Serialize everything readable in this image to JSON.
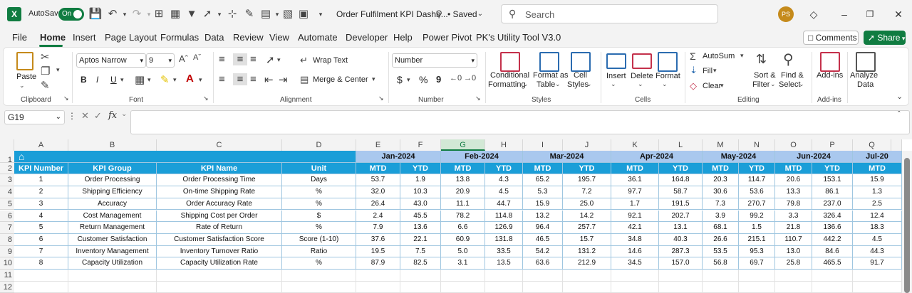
{
  "titlebar": {
    "app_logo": "X",
    "autosave_label": "AutoSave",
    "autosave_state": "On",
    "doc_title": "Order Fulfilment KPI Dashb...",
    "save_status": "• Saved",
    "search_placeholder": "Search",
    "avatar_initials": "PS"
  },
  "menu": {
    "items": [
      "File",
      "Home",
      "Insert",
      "Page Layout",
      "Formulas",
      "Data",
      "Review",
      "View",
      "Automate",
      "Developer",
      "Help",
      "Power Pivot",
      "PK's Utility Tool V3.0"
    ],
    "active": "Home",
    "comments_label": "Comments",
    "share_label": "Share"
  },
  "ribbon": {
    "clipboard": {
      "paste": "Paste",
      "label": "Clipboard"
    },
    "font": {
      "family": "Aptos Narrow",
      "size": "9",
      "bold": "B",
      "italic": "I",
      "underline": "U",
      "label": "Font"
    },
    "alignment": {
      "wrap_text": "Wrap Text",
      "merge_center": "Merge & Center",
      "label": "Alignment"
    },
    "number": {
      "format": "Number",
      "currency": "$",
      "percent": "%",
      "comma": "9",
      "label": "Number"
    },
    "styles": {
      "conditional": "Conditional",
      "formatting": "Formatting",
      "format_as": "Format as",
      "table": "Table",
      "cell": "Cell",
      "cell_styles": "Styles",
      "label": "Styles"
    },
    "cells": {
      "insert": "Insert",
      "delete": "Delete",
      "format": "Format",
      "label": "Cells"
    },
    "editing": {
      "autosum": "AutoSum",
      "fill": "Fill",
      "clear": "Clear",
      "sort": "Sort &",
      "filter": "Filter",
      "find": "Find &",
      "select": "Select",
      "label": "Editing"
    },
    "addins": {
      "addins": "Add-ins",
      "label": "Add-ins"
    },
    "analyze": {
      "line1": "Analyze",
      "line2": "Data"
    }
  },
  "formula_bar": {
    "name_box": "G19",
    "fx": "fx",
    "formula": ""
  },
  "grid": {
    "columns": [
      "A",
      "B",
      "C",
      "D",
      "E",
      "F",
      "G",
      "H",
      "I",
      "J",
      "K",
      "L",
      "M",
      "N",
      "O",
      "P",
      "Q"
    ],
    "selected_column": "G",
    "row_numbers": [
      "1",
      "2",
      "3",
      "4",
      "5",
      "6",
      "7",
      "8",
      "9",
      "10",
      "11",
      "12"
    ],
    "months": [
      "Jan-2024",
      "Feb-2024",
      "Mar-2024",
      "Apr-2024",
      "May-2024",
      "Jun-2024",
      "Jul-20"
    ],
    "headers": [
      "KPI Number",
      "KPI Group",
      "KPI Name",
      "Unit"
    ],
    "mtd": "MTD",
    "ytd": "YTD",
    "rows": [
      {
        "num": "1",
        "group": "Order Processing",
        "name": "Order Processing Time",
        "unit": "Days",
        "vals": [
          "53.7",
          "1.9",
          "13.8",
          "4.3",
          "65.2",
          "195.7",
          "36.1",
          "164.8",
          "20.3",
          "114.7",
          "20.6",
          "153.1",
          "15.9"
        ]
      },
      {
        "num": "2",
        "group": "Shipping Efficiency",
        "name": "On-time Shipping Rate",
        "unit": "%",
        "vals": [
          "32.0",
          "10.3",
          "20.9",
          "4.5",
          "5.3",
          "7.2",
          "97.7",
          "58.7",
          "30.6",
          "53.6",
          "13.3",
          "86.1",
          "1.3"
        ]
      },
      {
        "num": "3",
        "group": "Accuracy",
        "name": "Order Accuracy Rate",
        "unit": "%",
        "vals": [
          "26.4",
          "43.0",
          "11.1",
          "44.7",
          "15.9",
          "25.0",
          "1.7",
          "191.5",
          "7.3",
          "270.7",
          "79.8",
          "237.0",
          "2.5"
        ]
      },
      {
        "num": "4",
        "group": "Cost Management",
        "name": "Shipping Cost per Order",
        "unit": "$",
        "vals": [
          "2.4",
          "45.5",
          "78.2",
          "114.8",
          "13.2",
          "14.2",
          "92.1",
          "202.7",
          "3.9",
          "99.2",
          "3.3",
          "326.4",
          "12.4"
        ]
      },
      {
        "num": "5",
        "group": "Return Management",
        "name": "Rate of Return",
        "unit": "%",
        "vals": [
          "7.9",
          "13.6",
          "6.6",
          "126.9",
          "96.4",
          "257.7",
          "42.1",
          "13.1",
          "68.1",
          "1.5",
          "21.8",
          "136.6",
          "18.3"
        ]
      },
      {
        "num": "6",
        "group": "Customer Satisfaction",
        "name": "Customer Satisfaction Score",
        "unit": "Score (1-10)",
        "vals": [
          "37.6",
          "22.1",
          "60.9",
          "131.8",
          "46.5",
          "15.7",
          "34.8",
          "40.3",
          "26.6",
          "215.1",
          "110.7",
          "442.2",
          "4.5"
        ]
      },
      {
        "num": "7",
        "group": "Inventory Management",
        "name": "Inventory Turnover Ratio",
        "unit": "Ratio",
        "vals": [
          "19.5",
          "7.5",
          "5.0",
          "33.5",
          "54.2",
          "131.2",
          "14.6",
          "287.3",
          "53.5",
          "95.3",
          "13.0",
          "84.6",
          "44.3"
        ]
      },
      {
        "num": "8",
        "group": "Capacity Utilization",
        "name": "Capacity Utilization Rate",
        "unit": "%",
        "vals": [
          "87.9",
          "82.5",
          "3.1",
          "13.5",
          "63.6",
          "212.9",
          "34.5",
          "157.0",
          "56.8",
          "69.7",
          "25.8",
          "465.5",
          "91.7"
        ]
      }
    ]
  },
  "colors": {
    "excel_green": "#107c41",
    "header_blue": "#1a9ed8",
    "month_blue": "#a9c8ee"
  }
}
